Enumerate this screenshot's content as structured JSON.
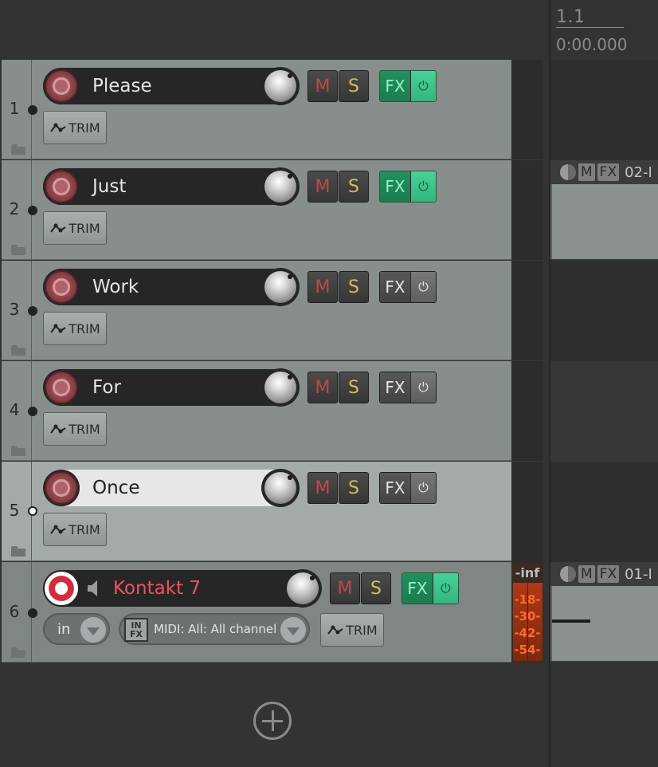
{
  "ruler": {
    "bar": "1.1",
    "time": "0:00.000"
  },
  "tracks": [
    {
      "num": "1",
      "name": "Please",
      "fx_active": true
    },
    {
      "num": "2",
      "name": "Just",
      "fx_active": true
    },
    {
      "num": "3",
      "name": "Work",
      "fx_active": false
    },
    {
      "num": "4",
      "name": "For",
      "fx_active": false
    },
    {
      "num": "5",
      "name": "Once",
      "fx_active": false,
      "selected": true
    },
    {
      "num": "6",
      "name": "Kontakt 7",
      "fx_active": true,
      "armed": true,
      "input": "in",
      "midi_input": "MIDI: All: All channel",
      "infx_label_1": "IN",
      "infx_label_2": "FX"
    }
  ],
  "buttons": {
    "mute": "M",
    "solo": "S",
    "fx": "FX",
    "trim": "TRIM",
    "power": "⏻"
  },
  "meter": {
    "inf": "-inf",
    "labels": [
      "-18-",
      "-30-",
      "-42-",
      "-54-"
    ]
  },
  "items": [
    {
      "mute": "M",
      "fx": "FX",
      "name": "02-I"
    },
    {
      "mute": "M",
      "fx": "FX",
      "name": "01-I"
    }
  ],
  "colors": {
    "track_bg": "#878e8b",
    "selected_track_bg": "#a3aaa8",
    "fx_on": "#1d7b51",
    "armed": "#d22b3a",
    "mute": "#c34747",
    "solo": "#d4bf55",
    "track_name_armed": "#f0525e"
  }
}
